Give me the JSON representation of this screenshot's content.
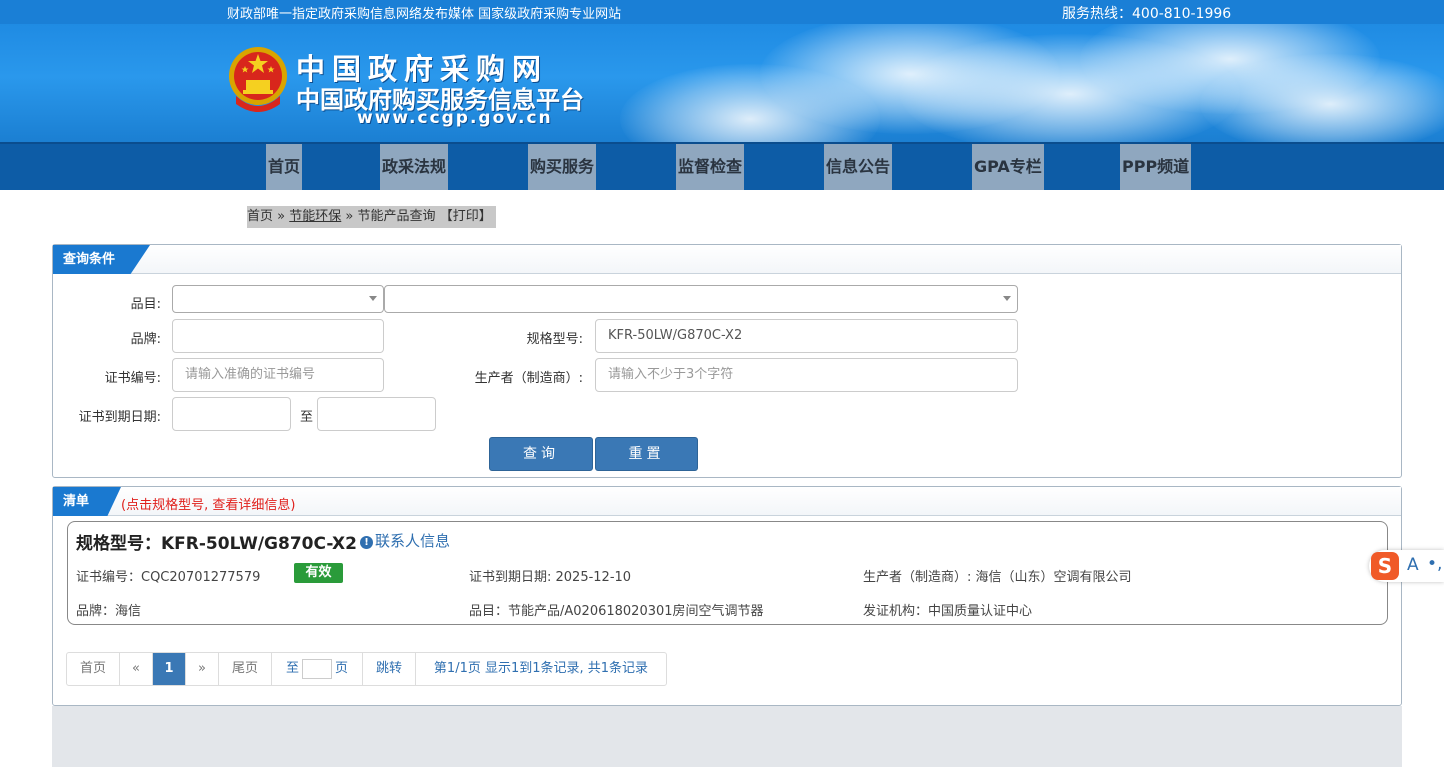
{
  "topbar": {
    "left_text": "财政部唯一指定政府采购信息网络发布媒体 国家级政府采购专业网站",
    "hotline": "服务热线：400-810-1996"
  },
  "logo": {
    "line1": "中国政府采购网",
    "line2": "中国政府购买服务信息平台",
    "line3": "www.ccgp.gov.cn"
  },
  "nav": {
    "items": [
      "首页",
      "政采法规",
      "购买服务",
      "监督检查",
      "信息公告",
      "GPA专栏",
      "PPP频道"
    ]
  },
  "breadcrumb": {
    "home": "首页",
    "sep1": "»",
    "section": "节能环保",
    "sep2": "»",
    "current": "节能产品查询",
    "print": "【打印】"
  },
  "query": {
    "tab_label": "查询条件",
    "category_label": "品目:",
    "brand_label": "品牌:",
    "brand_value": "",
    "model_label": "规格型号:",
    "model_value": "KFR-50LW/G870C-X2",
    "cert_label": "证书编号:",
    "cert_placeholder": "请输入准确的证书编号",
    "maker_label": "生产者（制造商）:",
    "maker_placeholder": "请输入不少于3个字符",
    "expiry_label": "证书到期日期:",
    "to_label": "至",
    "search_button": "查询",
    "reset_button": "重置"
  },
  "results": {
    "tab_label": "清单",
    "hint": "(点击规格型号, 查看详细信息)",
    "item": {
      "title": "规格型号：KFR-50LW/G870C-X2",
      "contact_icon": "info-circle-icon",
      "contact": "联系人信息",
      "cert_no": "证书编号：CQC20701277579",
      "status": "有效",
      "expiry": "证书到期日期: 2025-12-10",
      "maker": "生产者（制造商）: 海信（山东）空调有限公司",
      "brand": "品牌：海信",
      "category": "品目：节能产品/A020618020301房间空气调节器",
      "issuer": "发证机构：中国质量认证中心"
    },
    "pager": {
      "first": "首页",
      "prev": "«",
      "current": "1",
      "next": "»",
      "last": "尾页",
      "goto_prefix": "至",
      "goto_suffix": "页",
      "jump": "跳转",
      "summary": "第1/1页  显示1到1条记录, 共1条记录"
    }
  },
  "ime": {
    "logo": "S",
    "mode": "A",
    "dots": "•,"
  },
  "colors": {
    "brand_blue": "#1a7fd6",
    "nav_bg": "#0d5ca6",
    "button_blue": "#3a78b5",
    "status_green": "#2a9b3a",
    "hint_red": "#e0201c"
  }
}
